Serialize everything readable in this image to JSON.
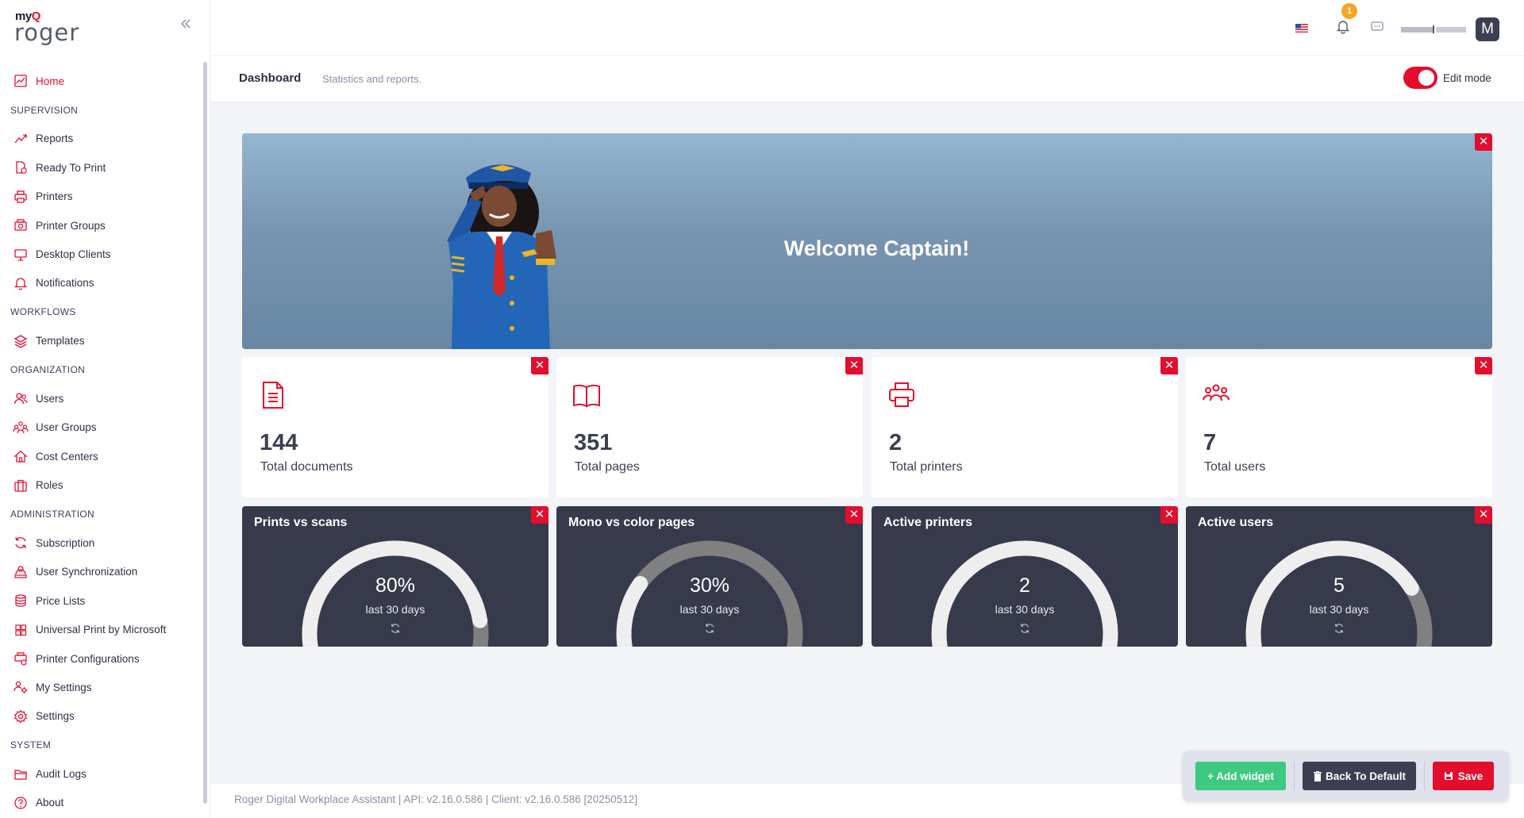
{
  "brand": {
    "logo_top": "myQ",
    "logo_bottom": "roger"
  },
  "sidebar": {
    "items": [
      {
        "type": "item",
        "label": "Home",
        "icon": "chart-line-icon",
        "active": true
      },
      {
        "type": "section",
        "label": "SUPERVISION"
      },
      {
        "type": "item",
        "label": "Reports",
        "icon": "trend-icon"
      },
      {
        "type": "item",
        "label": "Ready To Print",
        "icon": "file-clock-icon"
      },
      {
        "type": "item",
        "label": "Printers",
        "icon": "printer-icon"
      },
      {
        "type": "item",
        "label": "Printer Groups",
        "icon": "printer-group-icon"
      },
      {
        "type": "item",
        "label": "Desktop Clients",
        "icon": "monitor-icon"
      },
      {
        "type": "item",
        "label": "Notifications",
        "icon": "bell-icon"
      },
      {
        "type": "section",
        "label": "WORKFLOWS"
      },
      {
        "type": "item",
        "label": "Templates",
        "icon": "layers-icon"
      },
      {
        "type": "section",
        "label": "ORGANIZATION"
      },
      {
        "type": "item",
        "label": "Users",
        "icon": "users-icon"
      },
      {
        "type": "item",
        "label": "User Groups",
        "icon": "user-groups-icon"
      },
      {
        "type": "item",
        "label": "Cost Centers",
        "icon": "home-icon"
      },
      {
        "type": "item",
        "label": "Roles",
        "icon": "briefcase-icon"
      },
      {
        "type": "section",
        "label": "ADMINISTRATION"
      },
      {
        "type": "item",
        "label": "Subscription",
        "icon": "refresh-icon"
      },
      {
        "type": "item",
        "label": "User Synchronization",
        "icon": "user-sync-icon"
      },
      {
        "type": "item",
        "label": "Price Lists",
        "icon": "coins-icon"
      },
      {
        "type": "item",
        "label": "Universal Print by Microsoft",
        "icon": "windows-icon"
      },
      {
        "type": "item",
        "label": "Printer Configurations",
        "icon": "printer-config-icon"
      },
      {
        "type": "item",
        "label": "My Settings",
        "icon": "user-cog-icon"
      },
      {
        "type": "item",
        "label": "Settings",
        "icon": "gear-icon"
      },
      {
        "type": "section",
        "label": "SYSTEM"
      },
      {
        "type": "item",
        "label": "Audit Logs",
        "icon": "folder-icon"
      },
      {
        "type": "item",
        "label": "About",
        "icon": "help-circle-icon"
      }
    ]
  },
  "topbar": {
    "notification_count": "1",
    "avatar_letter": "M"
  },
  "header": {
    "title": "Dashboard",
    "subtitle": "Statistics and reports.",
    "edit_mode_label": "Edit mode",
    "edit_mode_on": true
  },
  "banner": {
    "title": "Welcome Captain!"
  },
  "stats": [
    {
      "value": "144",
      "label": "Total documents",
      "icon": "document-icon"
    },
    {
      "value": "351",
      "label": "Total pages",
      "icon": "book-icon"
    },
    {
      "value": "2",
      "label": "Total printers",
      "icon": "printer-icon"
    },
    {
      "value": "7",
      "label": "Total users",
      "icon": "users-icon"
    }
  ],
  "gauges": [
    {
      "title": "Prints vs scans",
      "value": "80%",
      "period": "last 30 days",
      "fraction": 0.8
    },
    {
      "title": "Mono vs color pages",
      "value": "30%",
      "period": "last 30 days",
      "fraction": 0.3
    },
    {
      "title": "Active printers",
      "value": "2",
      "period": "last 30 days",
      "fraction": 1.0
    },
    {
      "title": "Active users",
      "value": "5",
      "period": "last 30 days",
      "fraction": 0.714
    }
  ],
  "footer": {
    "text": "Roger Digital Workplace Assistant | API: v2.16.0.586 | Client: v2.16.0.586 [20250512]"
  },
  "actions": {
    "add_widget": "+ Add widget",
    "back_to_default": "Back To Default",
    "save": "Save"
  },
  "colors": {
    "accent": "#e30e2e",
    "success": "#3dc97f",
    "dark": "#363a4b",
    "warning": "#f5a623"
  }
}
